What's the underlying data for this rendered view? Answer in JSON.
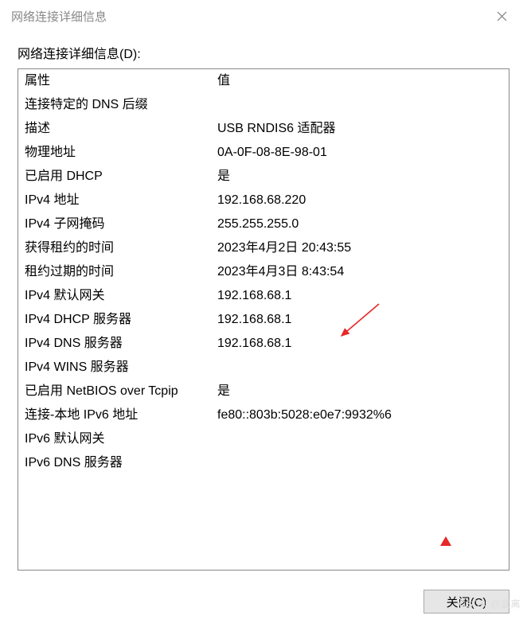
{
  "window": {
    "title": "网络连接详细信息",
    "section_label": "网络连接详细信息(D):",
    "col_property": "属性",
    "col_value": "值",
    "close_button": "关闭(C)",
    "watermark": "CSDN @蓝​离"
  },
  "rows": [
    {
      "prop": "连接特定的 DNS 后缀",
      "val": ""
    },
    {
      "prop": "描述",
      "val": "USB RNDIS6 适配器"
    },
    {
      "prop": "物理地址",
      "val": "0A-0F-08-8E-98-01"
    },
    {
      "prop": "已启用 DHCP",
      "val": "是"
    },
    {
      "prop": "IPv4 地址",
      "val": "192.168.68.220"
    },
    {
      "prop": "IPv4 子网掩码",
      "val": "255.255.255.0"
    },
    {
      "prop": "获得租约的时间",
      "val": "2023年4月2日 20:43:55"
    },
    {
      "prop": "租约过期的时间",
      "val": "2023年4月3日 8:43:54"
    },
    {
      "prop": "IPv4 默认网关",
      "val": "192.168.68.1"
    },
    {
      "prop": "IPv4 DHCP 服务器",
      "val": "192.168.68.1"
    },
    {
      "prop": "IPv4 DNS 服务器",
      "val": "192.168.68.1"
    },
    {
      "prop": "IPv4 WINS 服务器",
      "val": ""
    },
    {
      "prop": "已启用 NetBIOS over Tcpip",
      "val": "是"
    },
    {
      "prop": "连接-本地 IPv6 地址",
      "val": "fe80::803b:5028:e0e7:9932%6"
    },
    {
      "prop": "IPv6 默认网关",
      "val": ""
    },
    {
      "prop": "IPv6 DNS 服务器",
      "val": ""
    }
  ]
}
